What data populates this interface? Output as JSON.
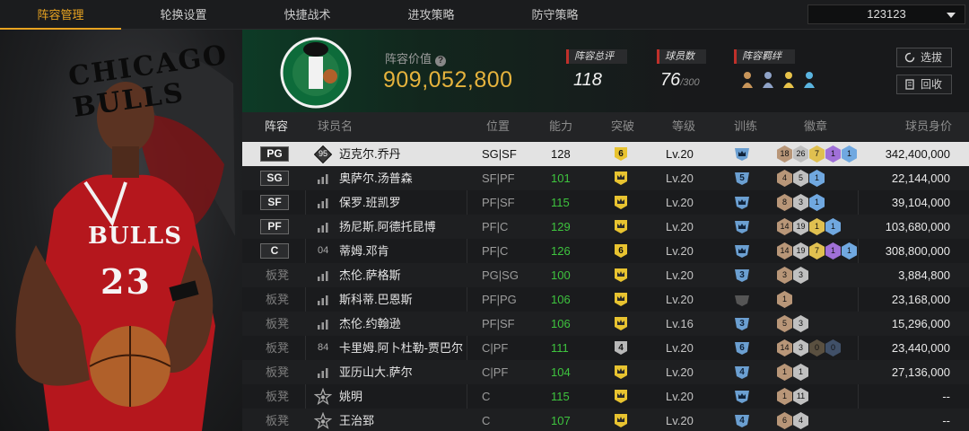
{
  "tabs": [
    {
      "label": "阵容管理",
      "active": true
    },
    {
      "label": "轮换设置"
    },
    {
      "label": "快捷战术"
    },
    {
      "label": "进攻策略"
    },
    {
      "label": "防守策略"
    }
  ],
  "selector": {
    "value": "123123"
  },
  "header": {
    "value_label": "阵容价值",
    "value": "909,052,800",
    "rating_label": "阵容总评",
    "rating": "118",
    "count_label": "球员数",
    "count": "76",
    "count_max": "/300",
    "chem_label": "阵容羁绊",
    "chem_colors": [
      "#c8955a",
      "#8fa3c8",
      "#e8c34a",
      "#5ab4e0"
    ],
    "btn_select": "选拔",
    "btn_recycle": "回收"
  },
  "featured_player": {
    "team_text": "CHICAGO BULLS",
    "jersey": "BULLS",
    "number": "23"
  },
  "columns": [
    "阵容",
    "球员名",
    "位置",
    "能力",
    "突破",
    "等级",
    "训练",
    "徽章",
    "球员身价"
  ],
  "players": [
    {
      "slot": "PG",
      "starter": true,
      "selected": true,
      "icon": "95",
      "name": "迈克尔.乔丹",
      "pos": "SG|SF",
      "rating": "128",
      "rating_color": "white",
      "tier": "6",
      "tier_color": "#e8c330",
      "level": "Lv.20",
      "train": "",
      "badges": [
        {
          "v": "18",
          "c": "#b89678"
        },
        {
          "v": "26",
          "c": "#c0c0c0"
        },
        {
          "v": "7",
          "c": "#e0c050"
        },
        {
          "v": "1",
          "c": "#a070d8"
        },
        {
          "v": "1",
          "c": "#70a8e0"
        }
      ],
      "salary": "342,400,000"
    },
    {
      "slot": "SG",
      "starter": true,
      "icon": "bars",
      "name": "奥萨尔.汤普森",
      "pos": "SF|PF",
      "rating": "101",
      "rating_color": "green",
      "tier": "",
      "level": "Lv.20",
      "train": "5",
      "badges": [
        {
          "v": "4",
          "c": "#b89678"
        },
        {
          "v": "5",
          "c": "#c0c0c0"
        },
        {
          "v": "1",
          "c": "#70a8e0"
        }
      ],
      "salary": "22,144,000"
    },
    {
      "slot": "SF",
      "starter": true,
      "icon": "bars",
      "name": "保罗.班凯罗",
      "pos": "PF|SF",
      "rating": "115",
      "rating_color": "green",
      "tier": "",
      "level": "Lv.20",
      "train": "",
      "badges": [
        {
          "v": "8",
          "c": "#b89678"
        },
        {
          "v": "3",
          "c": "#c0c0c0"
        },
        {
          "v": "1",
          "c": "#70a8e0"
        }
      ],
      "salary": "39,104,000"
    },
    {
      "slot": "PF",
      "starter": true,
      "icon": "bars",
      "name": "扬尼斯.阿德托昆博",
      "pos": "PF|C",
      "rating": "129",
      "rating_color": "green",
      "tier": "",
      "level": "Lv.20",
      "train": "",
      "badges": [
        {
          "v": "14",
          "c": "#b89678"
        },
        {
          "v": "19",
          "c": "#c0c0c0"
        },
        {
          "v": "1",
          "c": "#e0c050"
        },
        {
          "v": "1",
          "c": "#70a8e0"
        }
      ],
      "salary": "103,680,000"
    },
    {
      "slot": "C",
      "starter": true,
      "icon": "04",
      "name": "蒂姆.邓肯",
      "pos": "PF|C",
      "rating": "126",
      "rating_color": "green",
      "tier": "6",
      "tier_color": "#e8c330",
      "level": "Lv.20",
      "train": "",
      "badges": [
        {
          "v": "14",
          "c": "#b89678"
        },
        {
          "v": "19",
          "c": "#c0c0c0"
        },
        {
          "v": "7",
          "c": "#e0c050"
        },
        {
          "v": "1",
          "c": "#a070d8"
        },
        {
          "v": "1",
          "c": "#70a8e0"
        }
      ],
      "salary": "308,800,000"
    },
    {
      "slot": "板凳",
      "starter": false,
      "icon": "bars",
      "name": "杰伦.萨格斯",
      "pos": "PG|SG",
      "rating": "100",
      "rating_color": "green",
      "tier": "",
      "level": "Lv.20",
      "train": "3",
      "badges": [
        {
          "v": "3",
          "c": "#b89678"
        },
        {
          "v": "3",
          "c": "#c0c0c0"
        }
      ],
      "salary": "3,884,800"
    },
    {
      "slot": "板凳",
      "starter": false,
      "icon": "bars",
      "name": "斯科蒂.巴恩斯",
      "pos": "PF|PG",
      "rating": "106",
      "rating_color": "green",
      "tier": "",
      "level": "Lv.20",
      "train": "gray",
      "badges": [
        {
          "v": "1",
          "c": "#b89678"
        }
      ],
      "salary": "23,168,000"
    },
    {
      "slot": "板凳",
      "starter": false,
      "icon": "bars",
      "name": "杰伦.约翰逊",
      "pos": "PF|SF",
      "rating": "106",
      "rating_color": "green",
      "tier": "",
      "level": "Lv.16",
      "train": "3",
      "badges": [
        {
          "v": "5",
          "c": "#b89678"
        },
        {
          "v": "3",
          "c": "#c0c0c0"
        }
      ],
      "salary": "15,296,000"
    },
    {
      "slot": "板凳",
      "starter": false,
      "icon": "84",
      "name": "卡里姆.阿卜杜勒-贾巴尔",
      "pos": "C|PF",
      "rating": "111",
      "rating_color": "green",
      "tier": "4",
      "tier_color": "#b8b8b8",
      "level": "Lv.20",
      "train": "6",
      "badges": [
        {
          "v": "14",
          "c": "#b89678"
        },
        {
          "v": "3",
          "c": "#c0c0c0"
        },
        {
          "v": "0",
          "c": "#5a5040"
        },
        {
          "v": "0",
          "c": "#405068"
        }
      ],
      "salary": "23,440,000"
    },
    {
      "slot": "板凳",
      "starter": false,
      "icon": "bars",
      "name": "亚历山大.萨尔",
      "pos": "C|PF",
      "rating": "104",
      "rating_color": "green",
      "tier": "",
      "level": "Lv.20",
      "train": "4",
      "badges": [
        {
          "v": "1",
          "c": "#b89678"
        },
        {
          "v": "1",
          "c": "#c0c0c0"
        }
      ],
      "salary": "27,136,000"
    },
    {
      "slot": "板凳",
      "starter": false,
      "icon": "star",
      "name": "姚明",
      "pos": "C",
      "rating": "115",
      "rating_color": "green",
      "tier": "",
      "level": "Lv.20",
      "train": "",
      "badges": [
        {
          "v": "1",
          "c": "#b89678"
        },
        {
          "v": "11",
          "c": "#c0c0c0"
        }
      ],
      "salary": "--"
    },
    {
      "slot": "板凳",
      "starter": false,
      "icon": "star",
      "name": "王治郅",
      "pos": "C",
      "rating": "107",
      "rating_color": "green",
      "tier": "",
      "level": "Lv.20",
      "train": "4",
      "badges": [
        {
          "v": "6",
          "c": "#b89678"
        },
        {
          "v": "4",
          "c": "#c0c0c0"
        }
      ],
      "salary": "--"
    }
  ]
}
